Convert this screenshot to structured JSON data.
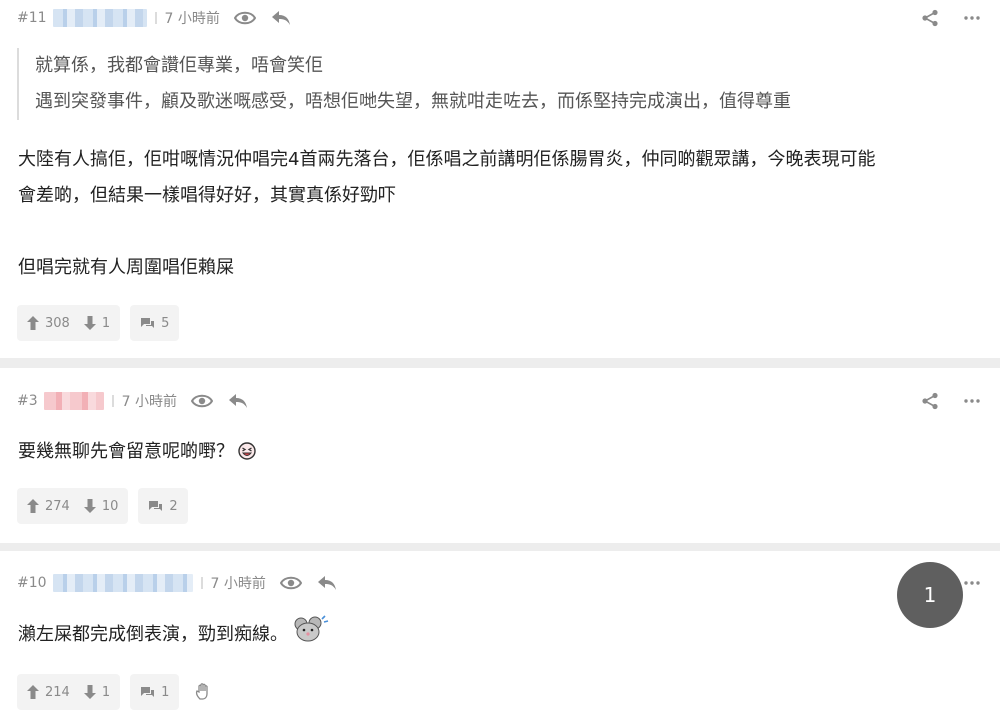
{
  "posts": [
    {
      "floor": "#11",
      "time": "7 小時前",
      "quote_lines": [
        "就算係，我都會讚佢專業，唔會笑佢",
        "遇到突發事件，顧及歌迷嘅感受，唔想佢哋失望，無就咁走咗去，而係堅持完成演出，值得尊重"
      ],
      "body_lines": [
        "大陸有人搞佢，佢咁嘅情況仲唱完4首兩先落台，佢係唱之前講明佢係腸胃炎，仲同啲觀眾講，今晚表現可能",
        "會差啲，但結果一樣唱得好好，其實真係好勁吓",
        "",
        "但唱完就有人周圍唱佢賴屎"
      ],
      "upvotes": "308",
      "downvotes": "1",
      "replies": "5"
    },
    {
      "floor": "#3",
      "time": "7 小時前",
      "body_lines": [
        "要幾無聊先會留意呢啲嘢？"
      ],
      "upvotes": "274",
      "downvotes": "10",
      "replies": "2"
    },
    {
      "floor": "#10",
      "time": "7 小時前",
      "body_lines": [
        "瀨左屎都完成倒表演，勁到痴線。"
      ],
      "upvotes": "214",
      "downvotes": "1",
      "replies": "1"
    }
  ],
  "icons": {
    "view": "eye-icon",
    "reply": "reply-arrow-icon",
    "share": "share-icon",
    "more": "more-dots-icon",
    "upvote": "thumb-up-arrow-icon",
    "downvote": "thumb-down-arrow-icon",
    "comments": "comment-bubble-icon",
    "hand": "hand-wave-icon"
  },
  "page_indicator": "1",
  "colors": {
    "separator": "#ededed",
    "meta_text": "#8a8a8a",
    "pill_bg": "#f3f3f3",
    "fab_bg": "#5f5f5f"
  }
}
